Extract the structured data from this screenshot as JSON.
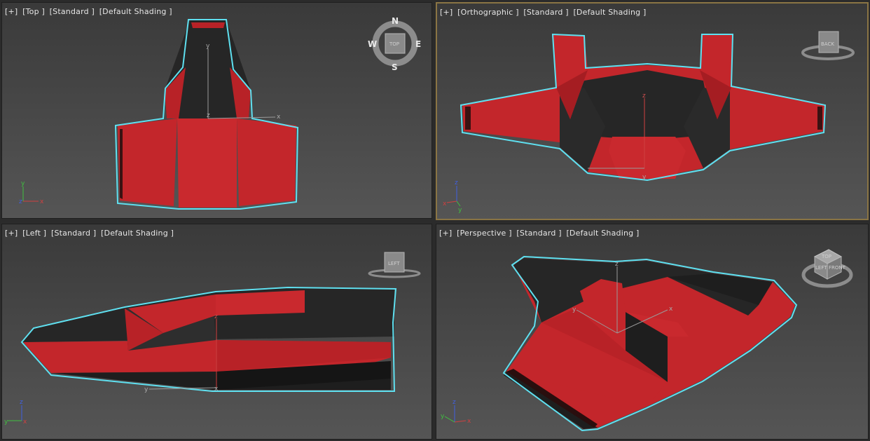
{
  "viewports": {
    "top": {
      "plus": "[+]",
      "view": "[Top ]",
      "style": "[Standard ]",
      "shading": "[Default Shading ]"
    },
    "ortho": {
      "plus": "[+]",
      "view": "[Orthographic ]",
      "style": "[Standard ]",
      "shading": "[Default Shading ]"
    },
    "left": {
      "plus": "[+]",
      "view": "[Left ]",
      "style": "[Standard ]",
      "shading": "[Default Shading ]"
    },
    "persp": {
      "plus": "[+]",
      "view": "[Perspective ]",
      "style": "[Standard ]",
      "shading": "[Default Shading ]"
    }
  },
  "viewcube": {
    "compass": {
      "n": "N",
      "s": "S",
      "e": "E",
      "w": "W"
    },
    "top_face": "TOP",
    "back_face": "BACK",
    "left_face": "LEFT",
    "persp_faces": {
      "top": "TOP",
      "front": "FRONT",
      "left": "LEFT"
    }
  },
  "axes": {
    "x": "x",
    "y": "y",
    "z": "z"
  },
  "colors": {
    "active_border": "#8a7444",
    "selection_outline": "#5fe0f0",
    "mesh_red": "#c3262b",
    "mesh_dark": "#1e1e1e",
    "axis_x": "#d04040",
    "axis_y": "#40c040",
    "axis_z": "#4060e0"
  }
}
